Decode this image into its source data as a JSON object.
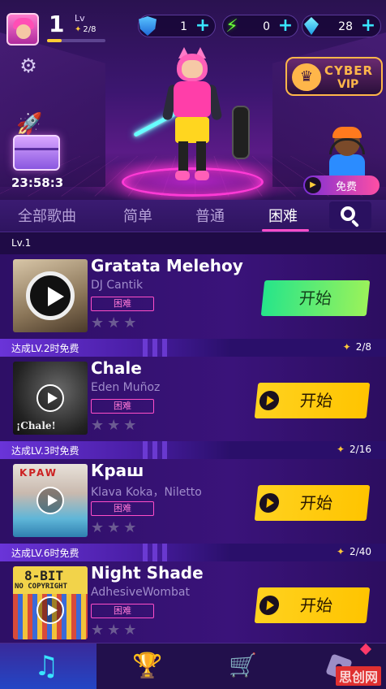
{
  "profile": {
    "level": "1",
    "level_label": "Lv",
    "xp": "2/8",
    "xp_progress": 0.25
  },
  "currency": {
    "shields": "1",
    "energy": "0",
    "gems": "28"
  },
  "events": {
    "chest_timer": "23:58:3",
    "vip_line1": "CYBER",
    "vip_line2": "VIP",
    "free_label": "免费"
  },
  "tabs": [
    {
      "label": "全部歌曲"
    },
    {
      "label": "简单"
    },
    {
      "label": "普通"
    },
    {
      "label": "困难"
    }
  ],
  "active_tab": "困难",
  "level_header": "Lv.1",
  "songs": [
    {
      "title": "Gratata Melehoy",
      "artist": "DJ Cantik",
      "difficulty": "困难",
      "stars": "★★★",
      "button": "开始",
      "button_style": "green"
    },
    {
      "title": "Chale",
      "artist": "Eden Muñoz",
      "difficulty": "困难",
      "stars": "★★★",
      "button": "开始",
      "button_style": "yellow",
      "cover_text": "¡Chale!"
    },
    {
      "title": "Краш",
      "artist": "Klava Koka，Niletto",
      "difficulty": "困难",
      "stars": "★★★",
      "button": "开始",
      "button_style": "yellow",
      "cover_text": "KPAW"
    },
    {
      "title": "Night Shade",
      "artist": "AdhesiveWombat",
      "difficulty": "困难",
      "stars": "★★★",
      "button": "开始",
      "button_style": "yellow",
      "cover_text": "8-BIT",
      "cover_text2": "NO COPYRIGHT"
    }
  ],
  "unlocks": [
    {
      "label": "达成LV.2时免费",
      "progress": "2/8"
    },
    {
      "label": "达成LV.3时免费",
      "progress": "2/16"
    },
    {
      "label": "达成LV.6时免费",
      "progress": "2/40"
    }
  ],
  "nav": [
    {
      "icon": "music-note-icon",
      "active": true
    },
    {
      "icon": "trophy-icon",
      "active": false
    },
    {
      "icon": "cart-icon",
      "active": false
    },
    {
      "icon": "dice-icon",
      "active": false
    }
  ],
  "watermark": "思创网"
}
